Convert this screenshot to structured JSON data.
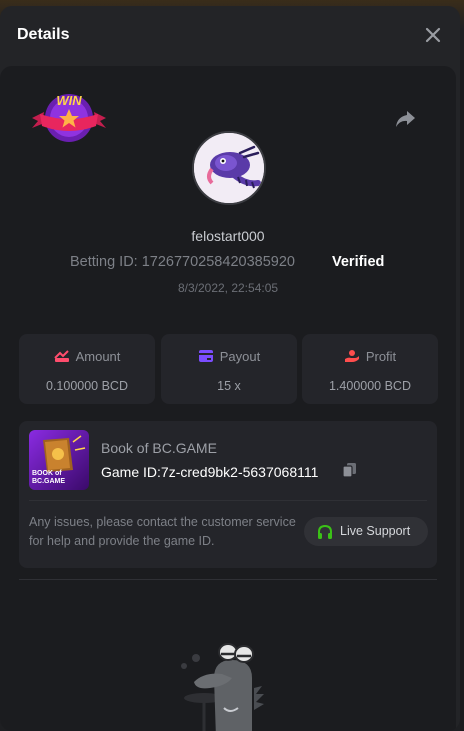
{
  "modal": {
    "title": "Details"
  },
  "win_badge_text": "WIN",
  "player": {
    "username": "felostart000",
    "betting_id_label": "Betting ID:",
    "betting_id": "1726770258420385920",
    "verified_label": "Verified",
    "timestamp": "8/3/2022, 22:54:05"
  },
  "stats": [
    {
      "label": "Amount",
      "value": "0.100000 BCD",
      "icon": "amount-icon",
      "color": "#ff4d6d"
    },
    {
      "label": "Payout",
      "value": "15 x",
      "icon": "payout-card-icon",
      "color": "#7b4dff"
    },
    {
      "label": "Profit",
      "value": "1.400000 BCD",
      "icon": "profit-hand-icon",
      "color": "#ff4d4d"
    }
  ],
  "game": {
    "name": "Book of BC.GAME",
    "id_label": "Game ID:",
    "id": "7z-cred9bk2-5637068111",
    "thumb_text": "BOOK of BC.GAME"
  },
  "support": {
    "text": "Any issues, please contact the customer service for help and provide the game ID.",
    "button_label": "Live Support",
    "icon": "headset-icon",
    "accent": "#3bc117"
  }
}
